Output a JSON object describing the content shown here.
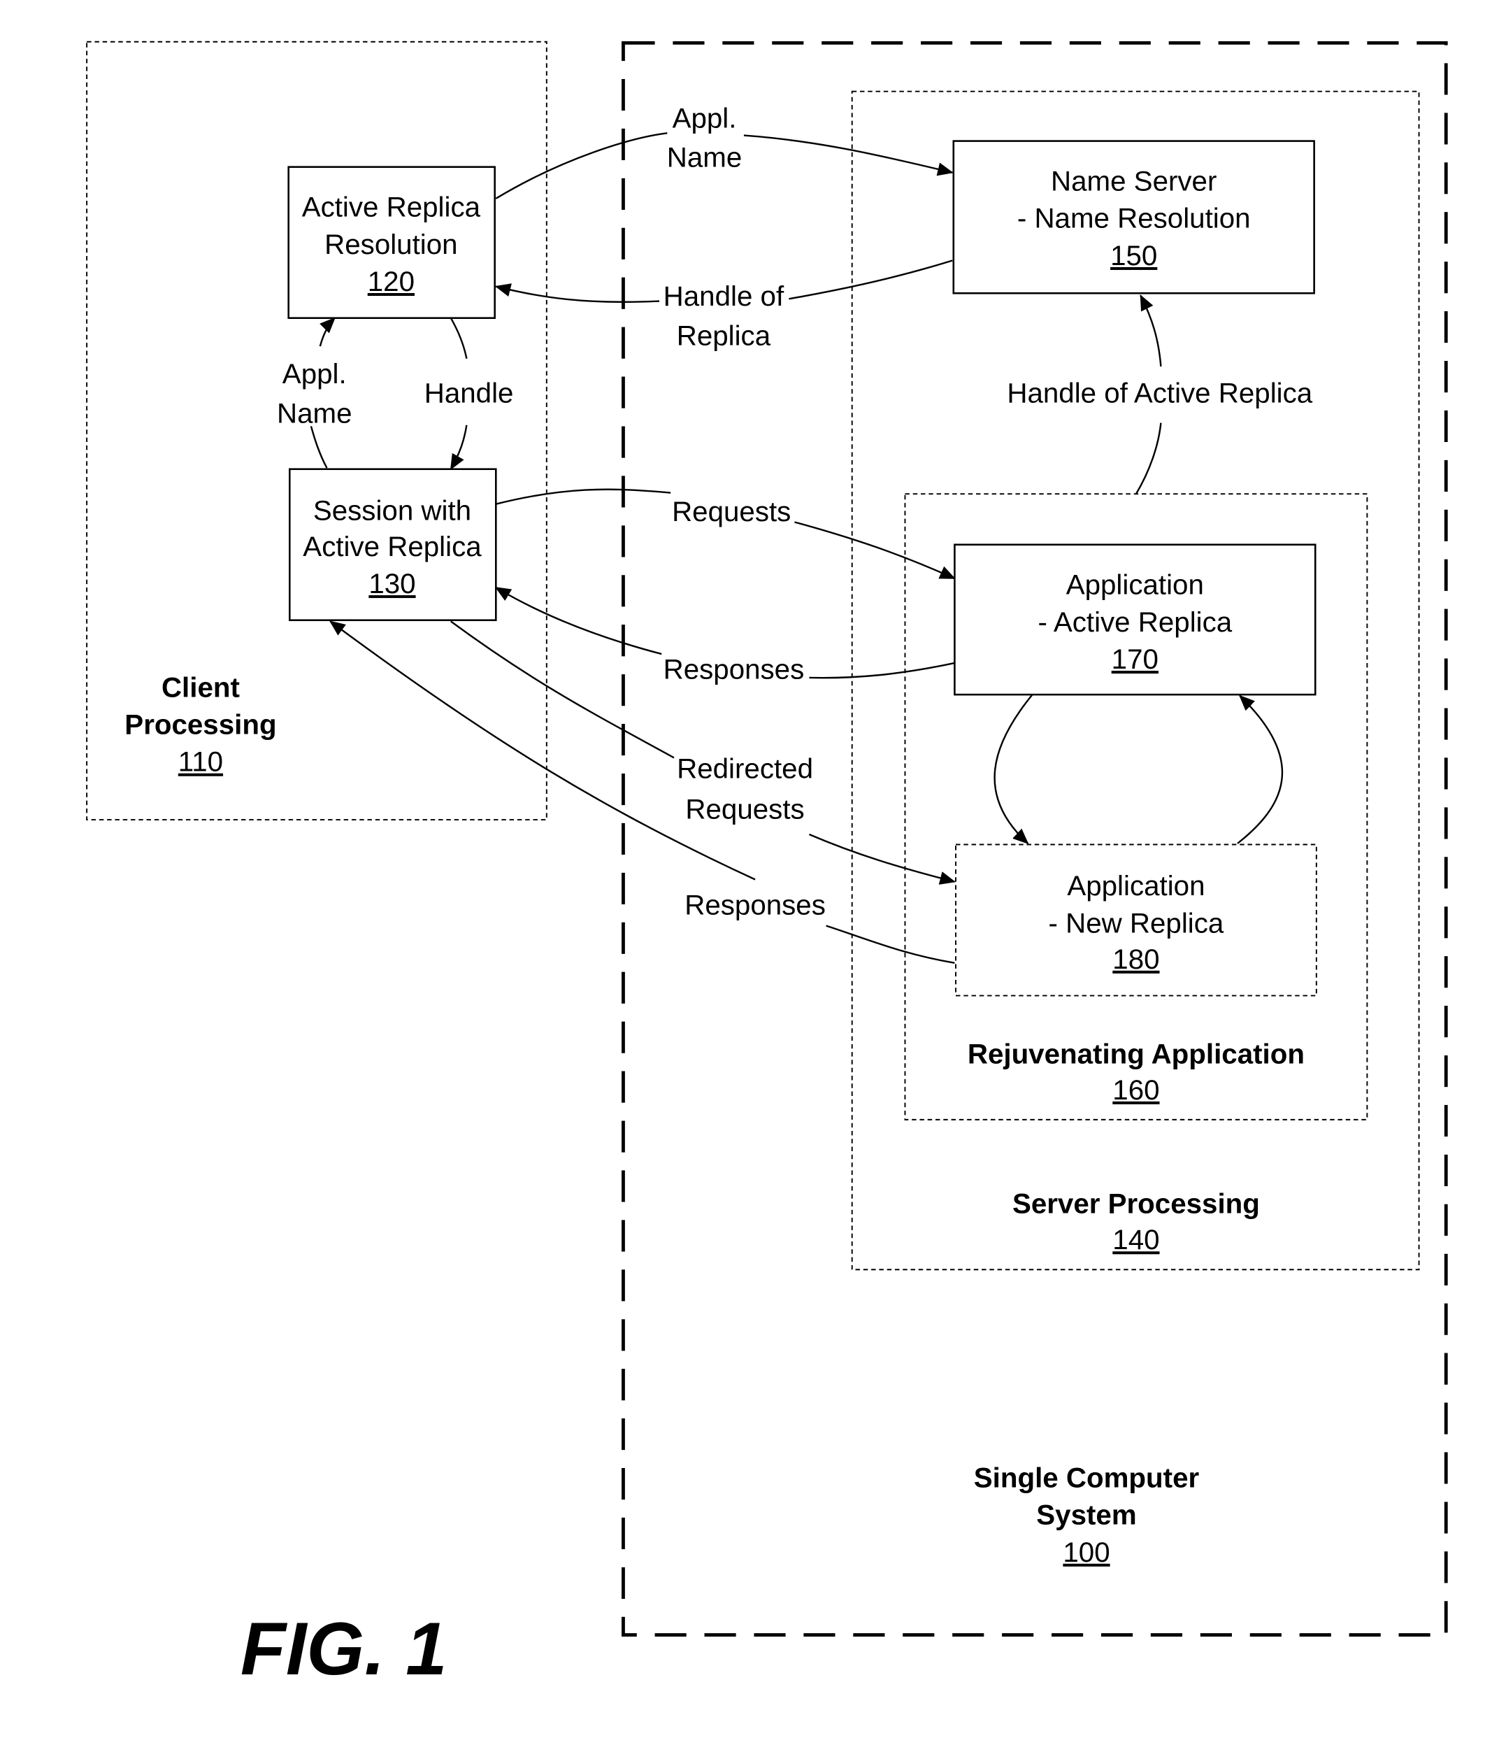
{
  "figure_label": "FIG. 1",
  "containers": {
    "client_processing": {
      "title_1": "Client",
      "title_2": "Processing",
      "ref": "110"
    },
    "single_computer_system": {
      "title_1": "Single Computer",
      "title_2": "System",
      "ref": "100"
    },
    "server_processing": {
      "title": "Server Processing",
      "ref": "140"
    },
    "rejuvenating_application": {
      "title": "Rejuvenating Application",
      "ref": "160"
    }
  },
  "blocks": {
    "active_replica_resolution": {
      "line1": "Active Replica",
      "line2": "Resolution",
      "ref": "120"
    },
    "session_with_active_replica": {
      "line1": "Session with",
      "line2": "Active Replica",
      "ref": "130"
    },
    "name_server": {
      "line1": "Name Server",
      "line2": "- Name Resolution",
      "ref": "150"
    },
    "application_active_replica": {
      "line1": "Application",
      "line2": "- Active Replica",
      "ref": "170"
    },
    "application_new_replica": {
      "line1": "Application",
      "line2": "- New Replica",
      "ref": "180"
    }
  },
  "connections": {
    "appl_name_to_name_server": {
      "line1": "Appl.",
      "line2": "Name"
    },
    "handle_of_replica": {
      "line1": "Handle of",
      "line2": "Replica"
    },
    "appl_name_internal": {
      "line1": "Appl.",
      "line2": "Name"
    },
    "handle_internal": {
      "line1": "Handle"
    },
    "handle_of_active_replica": {
      "line1": "Handle of Active Replica"
    },
    "requests": {
      "line1": "Requests"
    },
    "responses_active": {
      "line1": "Responses"
    },
    "redirected_requests": {
      "line1": "Redirected",
      "line2": "Requests"
    },
    "responses_new": {
      "line1": "Responses"
    }
  }
}
